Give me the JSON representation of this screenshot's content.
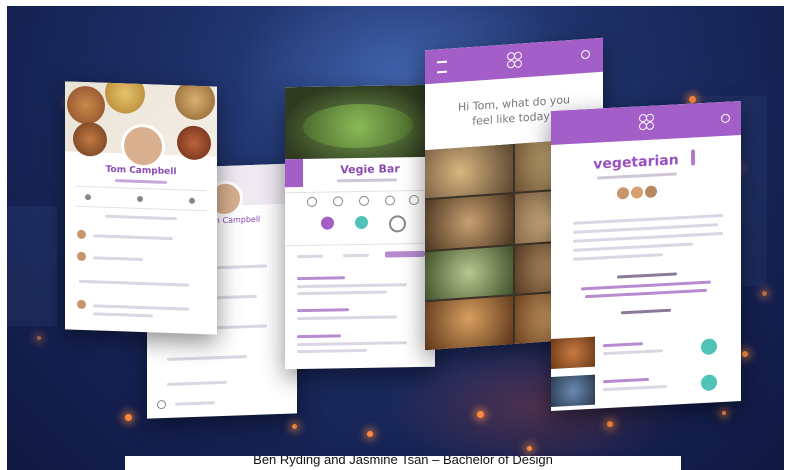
{
  "caption": "Ben Ryding and Jasmine Tsan – Bachelor of Design",
  "screens": {
    "profile_a": {
      "name": "Tom Campbell"
    },
    "profile_b": {
      "name": "Tom Campbell"
    },
    "restaurant": {
      "title": "Vegie Bar"
    },
    "home": {
      "prompt": "Hi Tom, what do you feel like today?"
    },
    "diet": {
      "title": "vegetarian"
    }
  },
  "colors": {
    "accent": "#a35fc7",
    "background": "#1b2b60",
    "bokeh": "#ff8a3d"
  },
  "icons": [
    "menu-icon",
    "logo-icon",
    "search-icon"
  ]
}
